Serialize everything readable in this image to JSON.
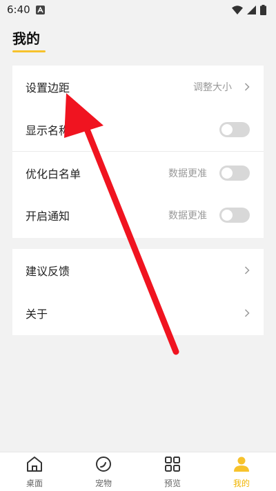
{
  "status_bar": {
    "time": "6:40"
  },
  "header": {
    "title": "我的"
  },
  "settings": {
    "group1": [
      {
        "label": "设置边距",
        "hint": "调整大小",
        "control": "chevron"
      },
      {
        "label": "显示名称",
        "hint": "",
        "control": "toggle",
        "value": "off"
      },
      {
        "label": "优化白名单",
        "hint": "数据更准",
        "control": "toggle",
        "value": "off"
      },
      {
        "label": "开启通知",
        "hint": "数据更准",
        "control": "toggle",
        "value": "off"
      }
    ],
    "group2": [
      {
        "label": "建议反馈",
        "control": "chevron"
      },
      {
        "label": "关于",
        "control": "chevron"
      }
    ]
  },
  "bottom_nav": {
    "items": [
      {
        "label": "桌面",
        "icon": "home-icon"
      },
      {
        "label": "宠物",
        "icon": "pet-icon"
      },
      {
        "label": "预览",
        "icon": "grid-icon"
      },
      {
        "label": "我的",
        "icon": "person-icon",
        "active": true
      }
    ]
  },
  "colors": {
    "accent": "#f7c22c",
    "active_nav": "#f0b400",
    "annotation_arrow": "#f01420",
    "toggle_off": "#d8d8d8",
    "background": "#f2f2f2"
  }
}
